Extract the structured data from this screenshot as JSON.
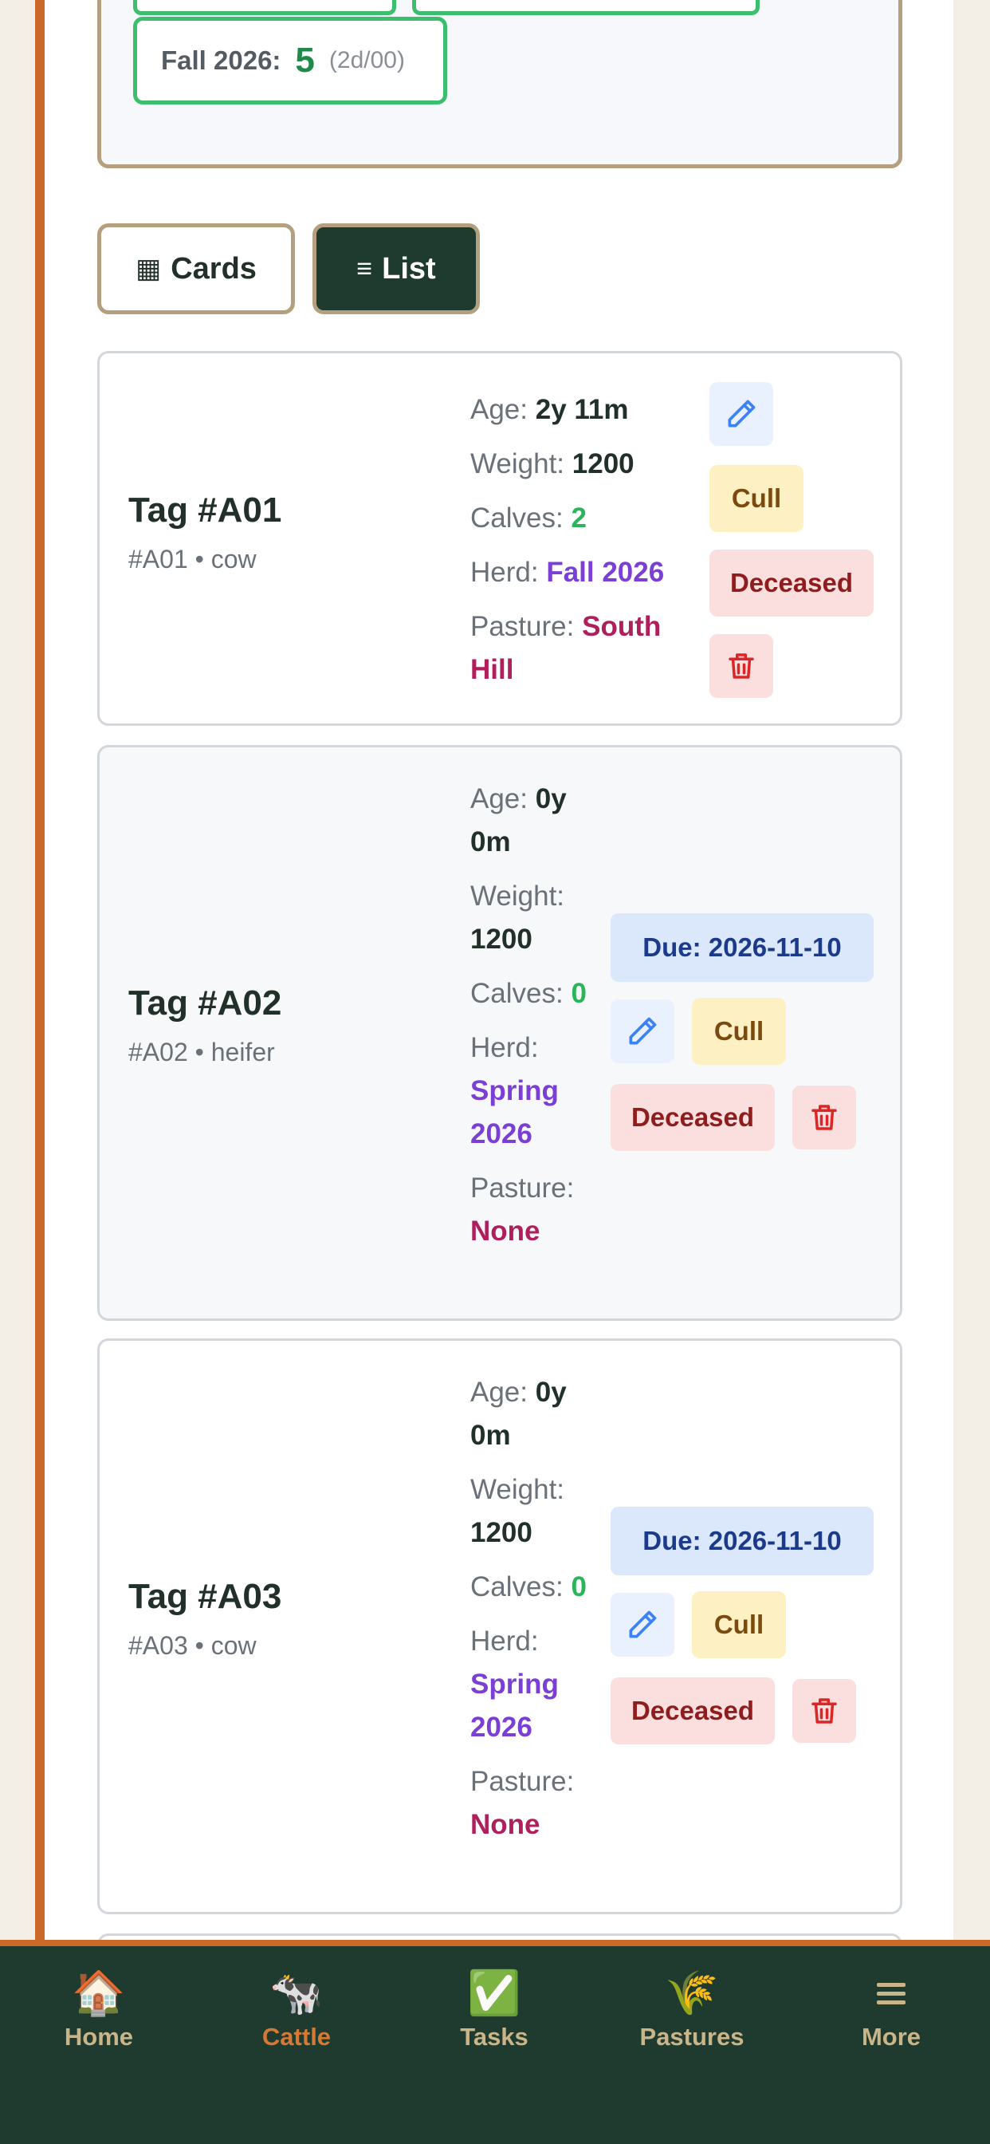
{
  "summary": {
    "herd_label": "Fall 2026:",
    "herd_count": "5",
    "herd_sub": "(2d/00)"
  },
  "view_toggle": {
    "cards_icon": "▦",
    "cards_label": "Cards",
    "list_icon": "≡",
    "list_label": "List",
    "active": "List"
  },
  "labels": {
    "age": "Age:",
    "weight": "Weight:",
    "calves": "Calves:",
    "herd": "Herd:",
    "pasture": "Pasture:",
    "cull": "Cull",
    "deceased": "Deceased"
  },
  "cattle": [
    {
      "tag": "Tag #A01",
      "meta": "#A01 • cow",
      "age": "2y 11m",
      "weight": "1200",
      "calves": "2",
      "herd": "Fall 2026",
      "pasture": "South Hill",
      "due": ""
    },
    {
      "tag": "Tag #A02",
      "meta": "#A02 • heifer",
      "age": "0y 0m",
      "weight": "1200",
      "calves": "0",
      "herd": "Spring 2026",
      "pasture": "None",
      "due": "Due: 2026-11-10"
    },
    {
      "tag": "Tag #A03",
      "meta": "#A03 • cow",
      "age": "0y 0m",
      "weight": "1200",
      "calves": "0",
      "herd": "Spring 2026",
      "pasture": "None",
      "due": "Due: 2026-11-10"
    }
  ],
  "nav": [
    {
      "label": "Home",
      "icon": "house-icon",
      "glyph": "🏠"
    },
    {
      "label": "Cattle",
      "icon": "cow-icon",
      "glyph": "🐄",
      "active": true
    },
    {
      "label": "Tasks",
      "icon": "checkmark-icon",
      "glyph": "✅"
    },
    {
      "label": "Pastures",
      "icon": "grain-icon",
      "glyph": "🌾"
    },
    {
      "label": "More",
      "icon": "menu-icon",
      "glyph": ""
    }
  ],
  "colors": {
    "accent_orange": "#c96a2a",
    "nav_bg": "#1f3a2e",
    "herd_purple": "#7c3fd6",
    "pasture_pink": "#b01e5c",
    "calves_green": "#2ab55c"
  }
}
